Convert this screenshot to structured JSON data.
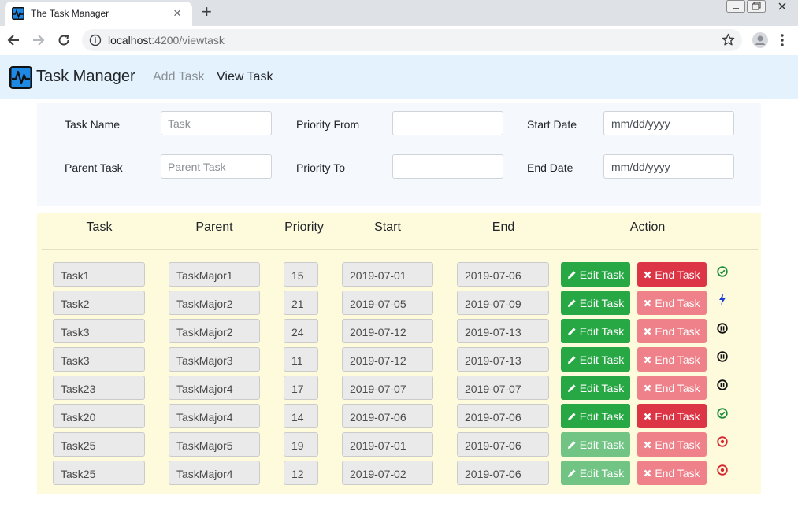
{
  "browser": {
    "tab_title": "The Task Manager",
    "tab_close": "×",
    "new_tab": "+",
    "url_host": "localhost",
    "url_path": ":4200/viewtask"
  },
  "app": {
    "brand": "Task Manager",
    "nav": [
      {
        "label": "Add Task",
        "active": false
      },
      {
        "label": "View Task",
        "active": true
      }
    ]
  },
  "filters": {
    "task_name_label": "Task Name",
    "task_name_placeholder": "Task",
    "parent_task_label": "Parent Task",
    "parent_task_placeholder": "Parent Task",
    "priority_from_label": "Priority From",
    "priority_to_label": "Priority To",
    "start_date_label": "Start Date",
    "end_date_label": "End Date",
    "date_placeholder": "mm/dd/yyyy"
  },
  "table": {
    "headers": [
      "Task",
      "Parent",
      "Priority",
      "Start",
      "End",
      "Action"
    ],
    "edit_label": "Edit Task",
    "end_label": "End Task",
    "colors": {
      "edit": "#28a745",
      "edit_disabled": "#71c484",
      "end": "#dc3545",
      "end_disabled": "#ee8189"
    },
    "rows": [
      {
        "task": "Task1",
        "parent": "TaskMajor1",
        "priority": "15",
        "start": "2019-07-01",
        "end": "2019-07-06",
        "edit_enabled": true,
        "end_enabled": true,
        "status": "check-circle-icon"
      },
      {
        "task": "Task2",
        "parent": "TaskMajor2",
        "priority": "21",
        "start": "2019-07-05",
        "end": "2019-07-09",
        "edit_enabled": true,
        "end_enabled": false,
        "status": "bolt-icon"
      },
      {
        "task": "Task3",
        "parent": "TaskMajor2",
        "priority": "24",
        "start": "2019-07-12",
        "end": "2019-07-13",
        "edit_enabled": true,
        "end_enabled": false,
        "status": "pause-circle-icon"
      },
      {
        "task": "Task3",
        "parent": "TaskMajor3",
        "priority": "11",
        "start": "2019-07-12",
        "end": "2019-07-13",
        "edit_enabled": true,
        "end_enabled": false,
        "status": "pause-circle-icon"
      },
      {
        "task": "Task23",
        "parent": "TaskMajor4",
        "priority": "17",
        "start": "2019-07-07",
        "end": "2019-07-07",
        "edit_enabled": true,
        "end_enabled": false,
        "status": "pause-circle-icon"
      },
      {
        "task": "Task20",
        "parent": "TaskMajor4",
        "priority": "14",
        "start": "2019-07-06",
        "end": "2019-07-06",
        "edit_enabled": true,
        "end_enabled": true,
        "status": "check-circle-icon"
      },
      {
        "task": "Task25",
        "parent": "TaskMajor5",
        "priority": "19",
        "start": "2019-07-01",
        "end": "2019-07-06",
        "edit_enabled": false,
        "end_enabled": false,
        "status": "stop-circle-icon"
      },
      {
        "task": "Task25",
        "parent": "TaskMajor4",
        "priority": "12",
        "start": "2019-07-02",
        "end": "2019-07-06",
        "edit_enabled": false,
        "end_enabled": false,
        "status": "stop-circle-icon"
      }
    ]
  }
}
